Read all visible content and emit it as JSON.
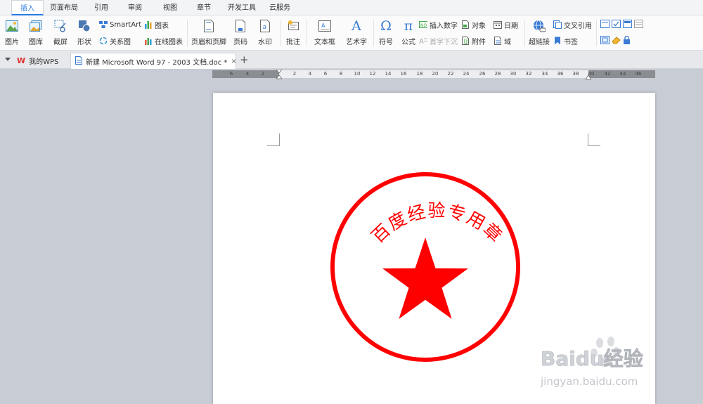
{
  "menu": {
    "tabs": [
      {
        "label": "插入",
        "active": true
      },
      {
        "label": "页面布局"
      },
      {
        "label": "引用"
      },
      {
        "label": "审阅"
      },
      {
        "label": "视图"
      },
      {
        "label": "章节"
      },
      {
        "label": "开发工具"
      },
      {
        "label": "云服务"
      }
    ]
  },
  "ribbon": {
    "picture": "图片",
    "gallery": "图库",
    "screenshot": "截屏",
    "shapes": "形状",
    "smartart": "SmartArt",
    "relation": "关系图",
    "chart": "图表",
    "online_chart": "在线图表",
    "header_footer": "页眉和页脚",
    "page_number": "页码",
    "watermark": "水印",
    "comment": "批注",
    "textbox": "文本框",
    "wordart": "艺术字",
    "symbol": "符号",
    "formula": "公式",
    "insert_number": "插入数字",
    "object": "对象",
    "date": "日期",
    "drop_cap": "首字下沉",
    "attachment": "附件",
    "field": "域",
    "hyperlink": "超链接",
    "cross_ref": "交叉引用",
    "bookmark": "书签",
    "symbol_glyph": "Ω",
    "formula_glyph": "π",
    "wordart_glyph": "A"
  },
  "tabs": {
    "home_tab": "我的WPS",
    "doc_tab": "新建 Microsoft Word 97 - 2003 文档.doc *",
    "add": "+"
  },
  "ruler": {
    "labels": [
      "6",
      "4",
      "2",
      "2",
      "4",
      "6",
      "8",
      "10",
      "12",
      "14",
      "16",
      "18",
      "20",
      "22",
      "24",
      "26",
      "28",
      "30",
      "32",
      "34",
      "36",
      "38",
      "40",
      "42",
      "44",
      "46"
    ]
  },
  "document": {
    "seal_text": "百度经验专用章",
    "seal_color": "#ff0000"
  },
  "watermark": {
    "brand": "Baidu经验",
    "url": "jingyan.baidu.com"
  }
}
